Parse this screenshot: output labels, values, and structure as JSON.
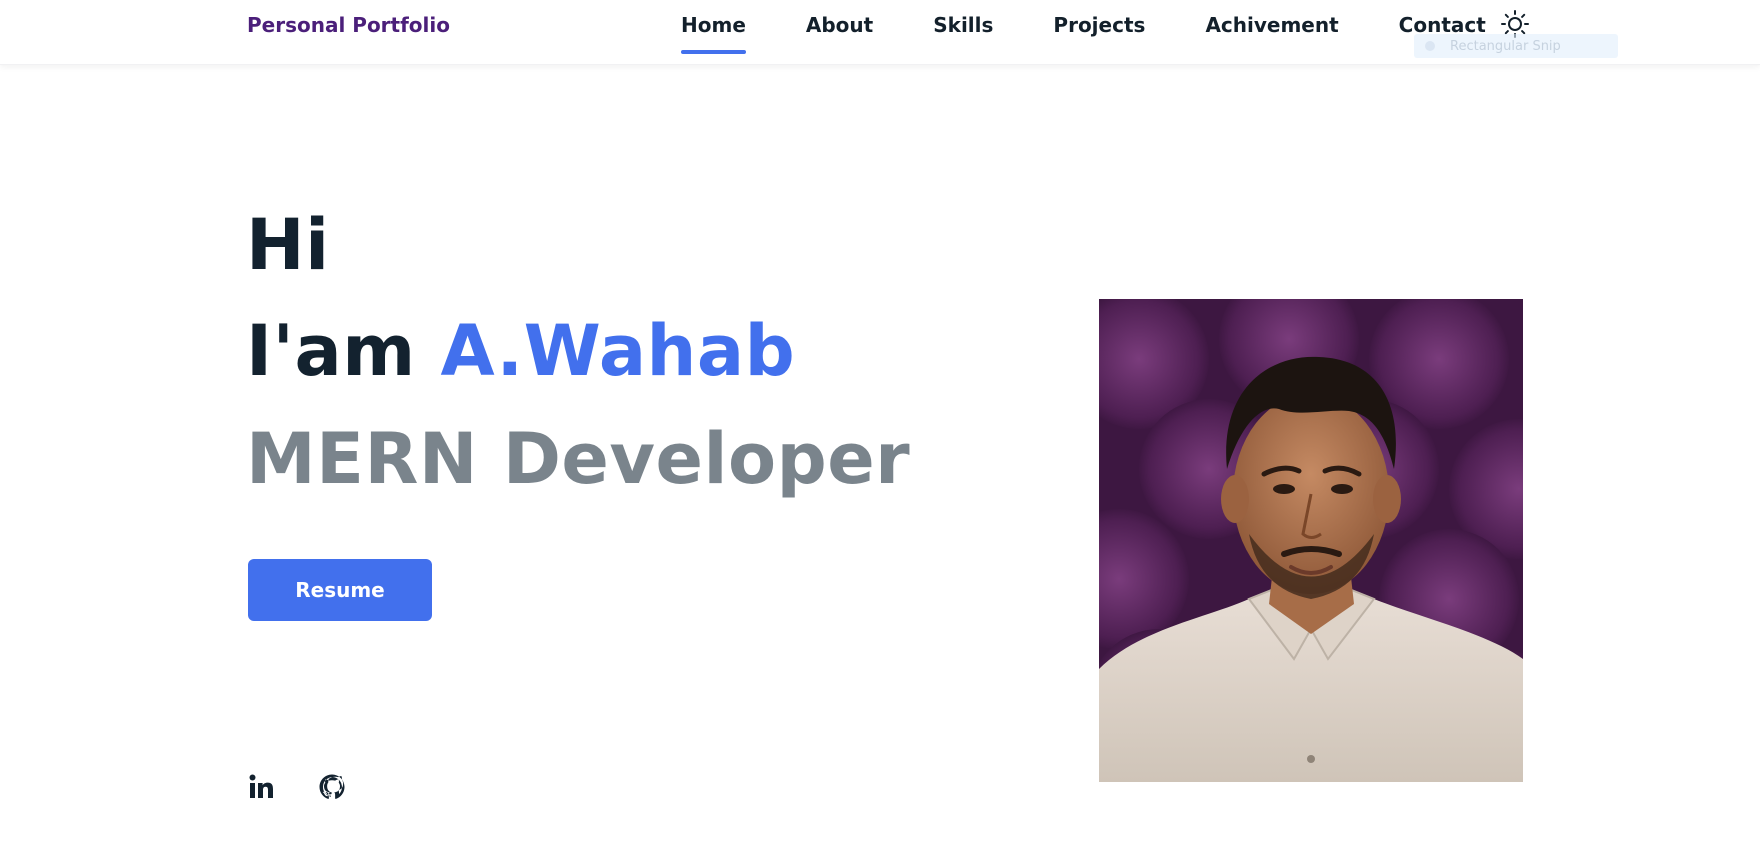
{
  "header": {
    "brand": "Personal Portfolio",
    "nav": [
      {
        "label": "Home",
        "active": true
      },
      {
        "label": "About",
        "active": false
      },
      {
        "label": "Skills",
        "active": false
      },
      {
        "label": "Projects",
        "active": false
      },
      {
        "label": "Achivement",
        "active": false
      },
      {
        "label": "Contact",
        "active": false
      }
    ],
    "theme_toggle_icon": "sun-icon",
    "snip_overlay_text": "Rectangular Snip"
  },
  "hero": {
    "greeting": "Hi",
    "intro_prefix": "I'am",
    "name": "A.Wahab",
    "role": "MERN Developer",
    "resume_label": "Resume"
  },
  "social": [
    {
      "icon": "linkedin-icon"
    },
    {
      "icon": "github-icon"
    }
  ],
  "colors": {
    "accent": "#4270ed",
    "brand": "#4b1f7a",
    "heading": "#13222f",
    "muted": "#7a848c"
  }
}
